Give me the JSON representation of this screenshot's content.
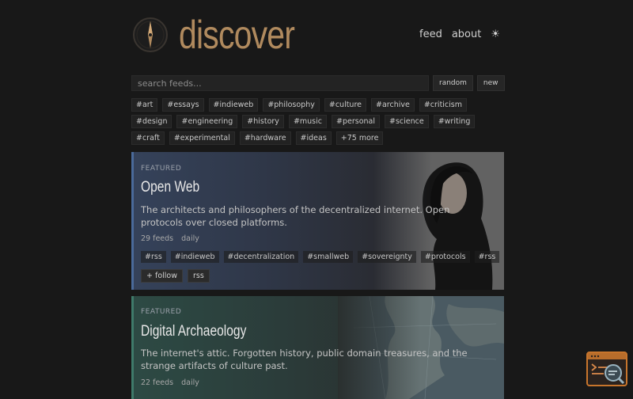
{
  "header": {
    "brand": "discover",
    "nav": [
      {
        "label": "feed"
      },
      {
        "label": "about"
      }
    ],
    "theme_toggle": "☀"
  },
  "search": {
    "placeholder": "search feeds...",
    "random_label": "random",
    "new_label": "new"
  },
  "tags": [
    "#art",
    "#essays",
    "#indieweb",
    "#philosophy",
    "#culture",
    "#archive",
    "#criticism",
    "#design",
    "#engineering",
    "#history",
    "#music",
    "#personal",
    "#science",
    "#writing",
    "#craft",
    "#experimental",
    "#hardware",
    "#ideas",
    "+75 more"
  ],
  "cards": [
    {
      "kicker": "FEATURED",
      "title": "Open Web",
      "description": "The architects and philosophers of the decentralized internet. Open protocols over closed platforms.",
      "feeds": "29 feeds",
      "frequency": "daily",
      "tags": [
        "#rss",
        "#indieweb",
        "#decentralization",
        "#smallweb",
        "#sovereignty",
        "#protocols",
        "#rss"
      ],
      "actions": [
        "+ follow",
        "rss"
      ]
    },
    {
      "kicker": "FEATURED",
      "title": "Digital Archaeology",
      "description": "The internet's attic. Forgotten history, public domain treasures, and the strange artifacts of culture past.",
      "feeds": "22 feeds",
      "frequency": "daily"
    }
  ],
  "colors": {
    "background": "#181818",
    "brand": "#b08a5e",
    "card1_accent": "#4a6a9a",
    "card2_accent": "#3f7a6a",
    "widget_accent": "#c8752c"
  },
  "icons": {
    "logo": "compass-icon",
    "widget": "reader-search-icon"
  }
}
